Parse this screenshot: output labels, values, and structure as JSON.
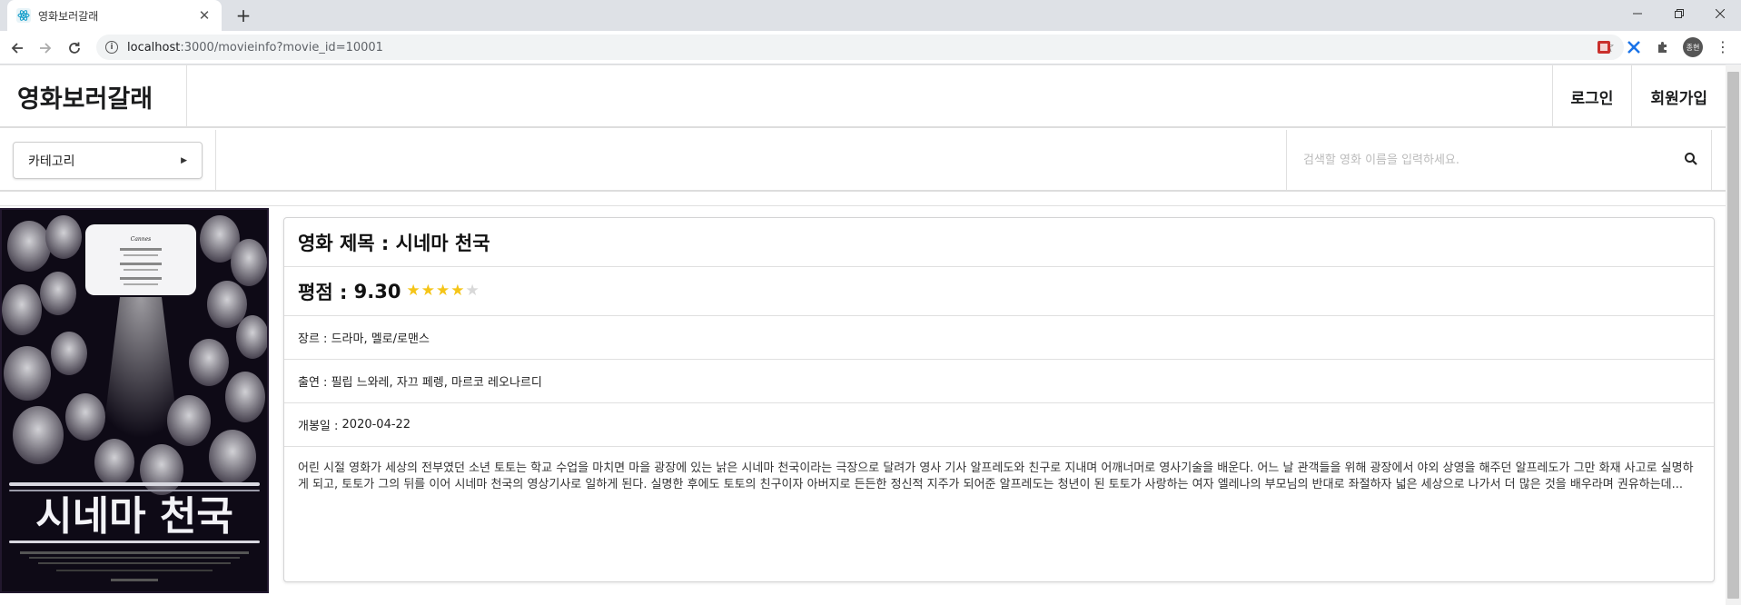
{
  "browser": {
    "tab_title": "영화보러갈래",
    "tab_close": "✕",
    "new_tab": "+",
    "url_host": "localhost",
    "url_path": ":3000/movieinfo?movie_id=10001",
    "avatar_text": "종현"
  },
  "header": {
    "brand": "영화보러갈래",
    "login": "로그인",
    "signup": "회원가입"
  },
  "subnav": {
    "category_label": "카테고리",
    "search_placeholder": "검색할 영화 이름을 입력하세요."
  },
  "poster": {
    "title_text": "시네마 천국",
    "festival_mark": "Cannes"
  },
  "movie": {
    "title_label": "영화 제목 : ",
    "title": "시네마 천국",
    "rating_label": "평점 : ",
    "rating": "9.30",
    "rating_stars": 4,
    "rating_max_stars": 5,
    "genre_label": "장르 : ",
    "genre": "드라마, 멜로/로맨스",
    "cast_label": "출연 : ",
    "cast": "필립 느와레, 자끄 페렝, 마르코 레오나르디",
    "release_label": "개봉일 : ",
    "release_date": "2020-04-22",
    "synopsis": "어린 시절 영화가 세상의 전부였던 소년 토토는 학교 수업을 마치면 마을 광장에 있는 낡은 시네마 천국이라는 극장으로 달려가 영사 기사 알프레도와 친구로 지내며 어깨너머로 영사기술을 배운다. 어느 날 관객들을 위해 광장에서 야외 상영을 해주던 알프레도가 그만 화재 사고로 실명하게 되고, 토토가 그의 뒤를 이어 시네마 천국의 영상기사로 일하게 된다. 실명한 후에도 토토의 친구이자 아버지로 든든한 정신적 지주가 되어준 알프레도는 청년이 된 토토가 사랑하는 여자 엘레나의 부모님의 반대로 좌절하자 넓은 세상으로 나가서 더 많은 것을 배우라며 권유하는데..."
  },
  "colors": {
    "star_on": "#f5c518",
    "star_off": "#d8d8d8",
    "poster_bg": "#0e0a16"
  }
}
